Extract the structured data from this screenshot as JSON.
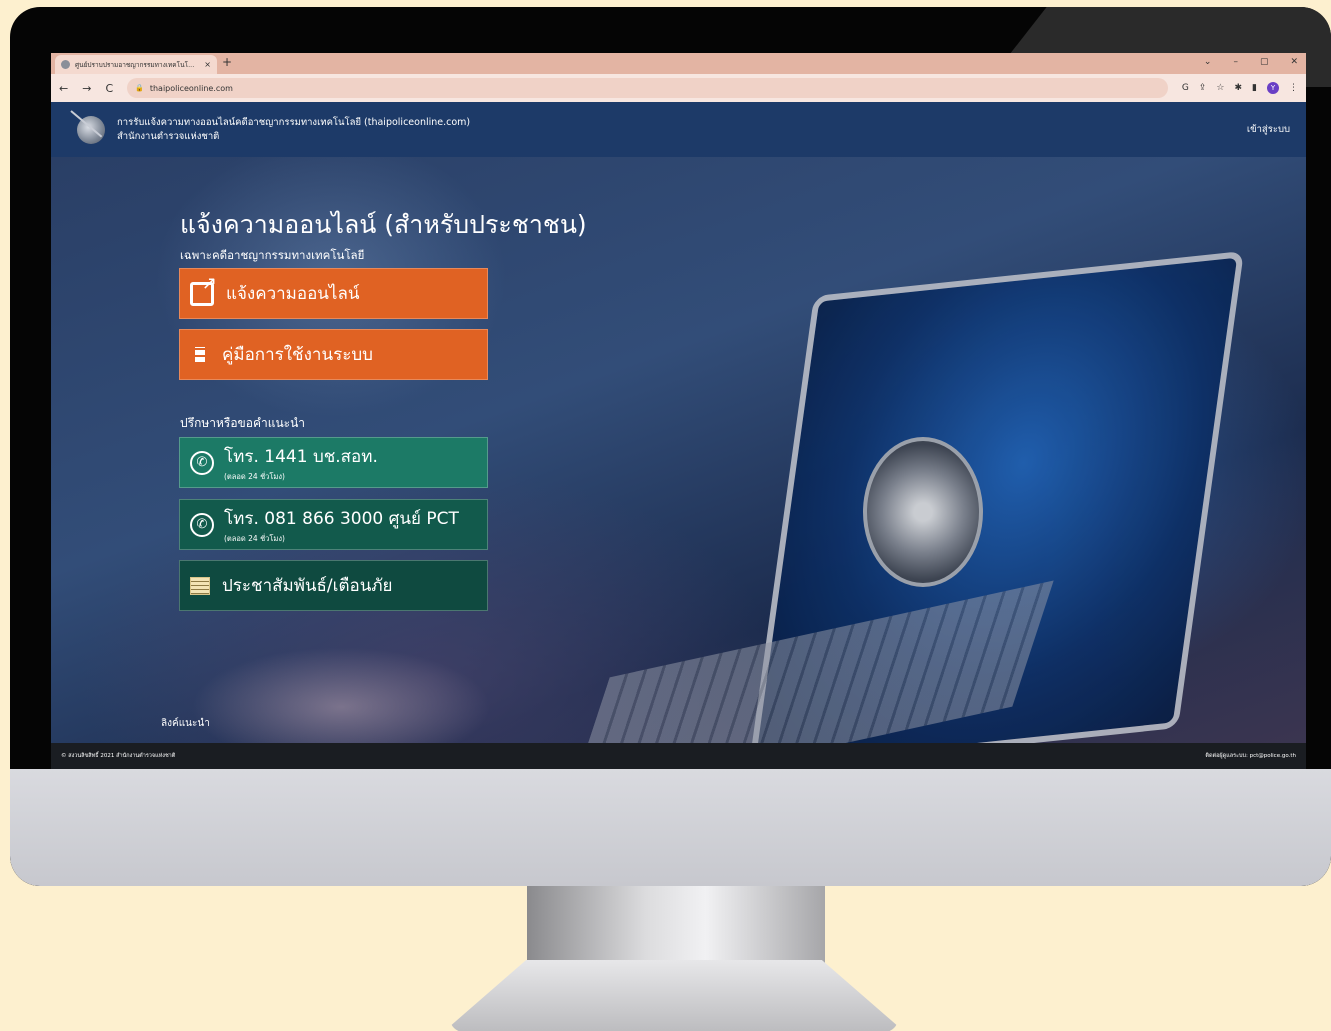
{
  "browser": {
    "tab_title": "ศูนย์ปราบปรามอาชญากรรมทางเทคโนโ...",
    "tab_close": "×",
    "new_tab": "+",
    "window_controls": [
      "⌄",
      "–",
      "▢",
      "✕"
    ],
    "nav": {
      "back": "←",
      "forward": "→",
      "reload": "C"
    },
    "url": "thaipoliceonline.com",
    "toolbar_icons": [
      "google-icon",
      "share-icon",
      "star-icon",
      "extension-icon",
      "sidepanel-icon"
    ],
    "profile_initial": "Y",
    "menu": "⋮"
  },
  "header": {
    "title_line1": "การรับแจ้งความทางออนไลน์คดีอาชญากรรมทางเทคโนโลยี (thaipoliceonline.com)",
    "title_line2": "สำนักงานตำรวจแห่งชาติ",
    "login": "เข้าสู่ระบบ"
  },
  "hero": {
    "title": "แจ้งความออนไลน์ (สำหรับประชาชน)",
    "subtitle": "เฉพาะคดีอาชญากรรมทางเทคโนโลยี",
    "buttons": {
      "report": "แจ้งความออนไลน์",
      "manual": "คู่มือการใช้งานระบบ"
    },
    "consult_heading": "ปรึกษาหรือขอคำแนะนำ",
    "contacts": [
      {
        "label": "โทร. 1441 บช.สอท.",
        "note": "(ตลอด 24 ชั่วโมง)"
      },
      {
        "label": "โทร. 081 866 3000 ศูนย์ PCT",
        "note": "(ตลอด 24 ชั่วโมง)"
      }
    ],
    "news": "ประชาสัมพันธ์/เตือนภัย",
    "recommended_link": "ลิงค์แนะนำ"
  },
  "footer": {
    "copyright": "© สงวนลิขสิทธิ์ 2021 สำนักงานตำรวจแห่งชาติ",
    "contact": "ติดต่อผู้ดูแลระบบ: pct@police.go.th"
  },
  "colors": {
    "accent_orange": "#e06223",
    "teal": "#1c7a66",
    "dark_teal": "#125a4c",
    "header_blue": "#1d3a68",
    "background": "#fdf0cf"
  }
}
